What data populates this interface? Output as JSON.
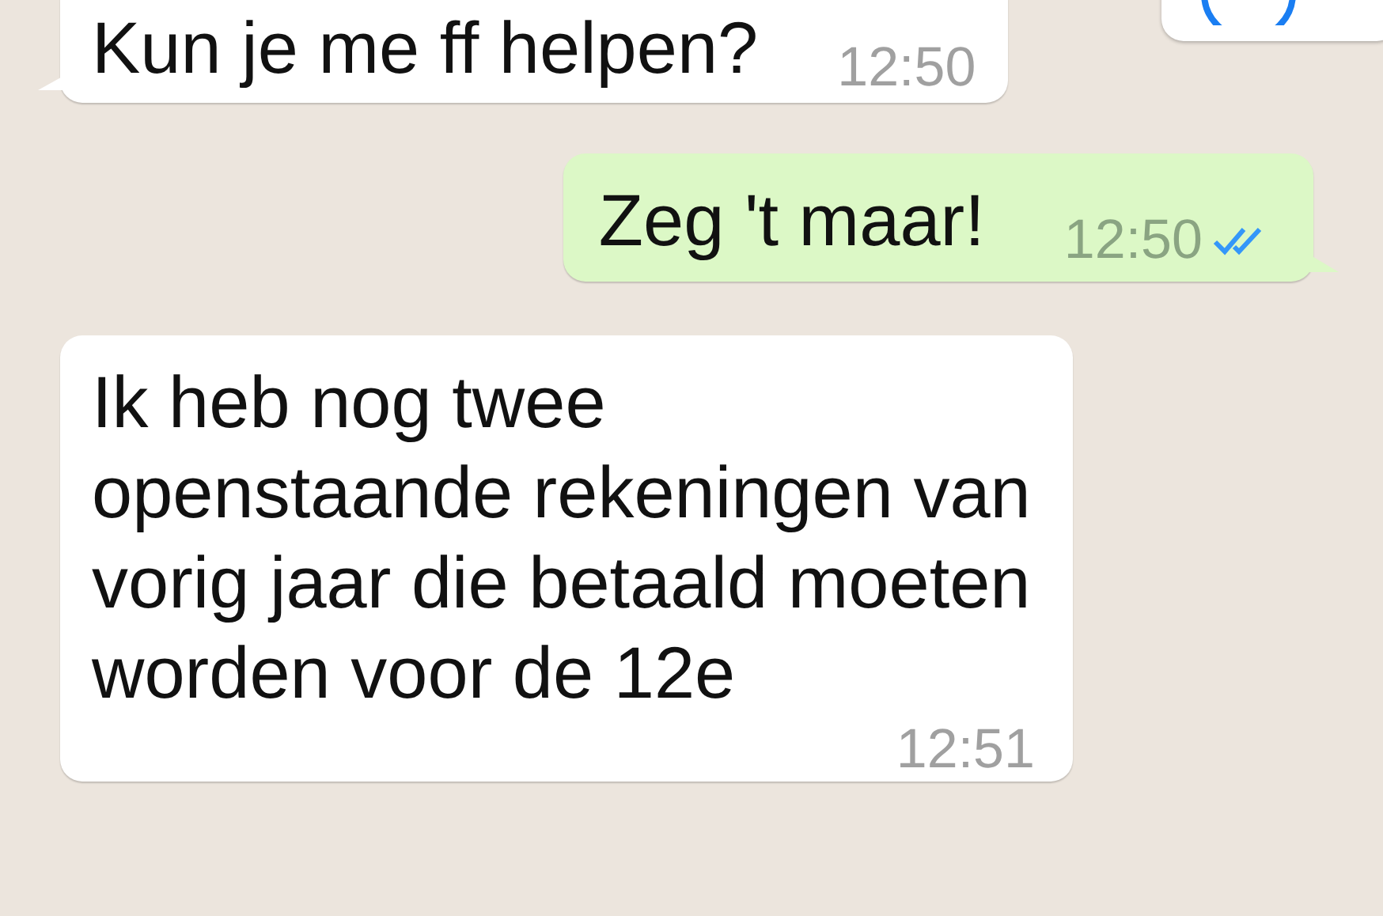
{
  "messages": [
    {
      "kind": "incoming",
      "text": "Kun je me ff helpen?",
      "time": "12:50"
    },
    {
      "kind": "outgoing",
      "text": "Zeg 't maar!",
      "time": "12:50",
      "read": true
    },
    {
      "kind": "incoming",
      "text": "Ik heb nog twee openstaande rekeningen van vorig jaar die betaald moeten worden voor de 12e",
      "time": "12:51"
    }
  ]
}
